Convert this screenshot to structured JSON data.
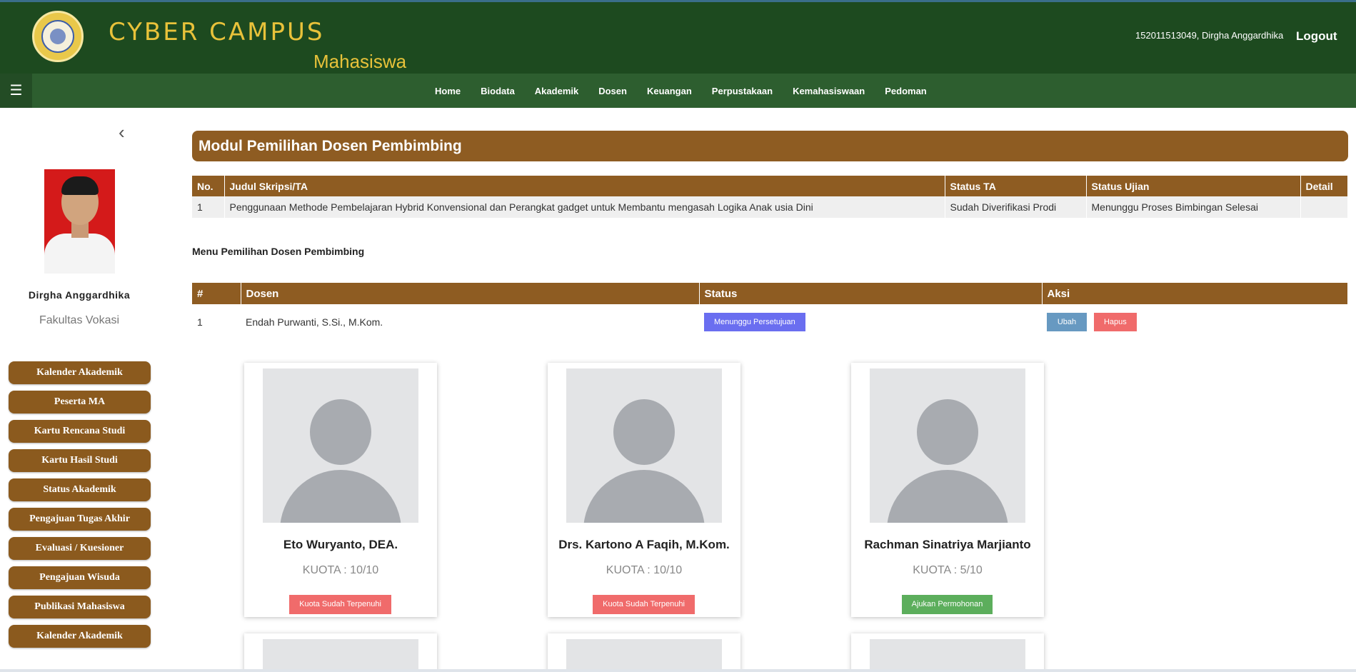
{
  "header": {
    "brand": "CYBER CAMPUS",
    "role": "Mahasiswa",
    "user": "152011513049, Dirgha Anggardhika",
    "logout": "Logout"
  },
  "nav": {
    "items": [
      "Home",
      "Biodata",
      "Akademik",
      "Dosen",
      "Keuangan",
      "Perpustakaan",
      "Kemahasiswaan",
      "Pedoman"
    ]
  },
  "sidebar": {
    "name": "Dirgha Anggardhika",
    "faculty": "Fakultas Vokasi",
    "menu": [
      "Kalender Akademik",
      "Peserta MA",
      "Kartu Rencana Studi",
      "Kartu Hasil Studi",
      "Status Akademik",
      "Pengajuan Tugas Akhir",
      "Evaluasi / Kuesioner",
      "Pengajuan Wisuda",
      "Publikasi Mahasiswa",
      "Kalender Akademik"
    ]
  },
  "module": {
    "title": "Modul Pemilihan Dosen Pembimbing"
  },
  "ta_table": {
    "headers": [
      "No.",
      "Judul Skripsi/TA",
      "Status TA",
      "Status Ujian",
      "Detail"
    ],
    "rows": [
      [
        "1",
        "Penggunaan Methode Pembelajaran Hybrid Konvensional dan Perangkat gadget untuk Membantu mengasah Logika Anak usia Dini",
        "Sudah Diverifikasi Prodi",
        "Menunggu Proses Bimbingan Selesai",
        ""
      ]
    ]
  },
  "menu_label": "Menu Pemilihan Dosen Pembimbing",
  "dosen_table": {
    "headers": [
      "#",
      "Dosen",
      "Status",
      "Aksi"
    ],
    "rows": [
      {
        "no": "1",
        "dosen": "Endah Purwanti, S.Si., M.Kom.",
        "status": "Menunggu Persetujuan",
        "ubah": "Ubah",
        "hapus": "Hapus"
      }
    ]
  },
  "cards": [
    {
      "name": "Eto Wuryanto, DEA.",
      "quota": "KUOTA : 10/10",
      "button": "Kuota Sudah Terpenuhi"
    },
    {
      "name": "Drs. Kartono A Faqih, M.Kom.",
      "quota": "KUOTA : 10/10",
      "button": "Kuota Sudah Terpenuhi"
    },
    {
      "name": "Rachman Sinatriya Marjianto",
      "quota": "KUOTA : 5/10",
      "button": "Ajukan Permohonan"
    }
  ],
  "colors": {
    "header_bg": "#1d4a1f",
    "nav_bg": "#2d5e2f",
    "brand_gold": "#e8c23a",
    "brown": "#8e5c22",
    "badge_blue": "#6a6ef0",
    "btn_red": "#f06b6b",
    "btn_green": "#5cae5c",
    "btn_steel": "#6799c1"
  }
}
